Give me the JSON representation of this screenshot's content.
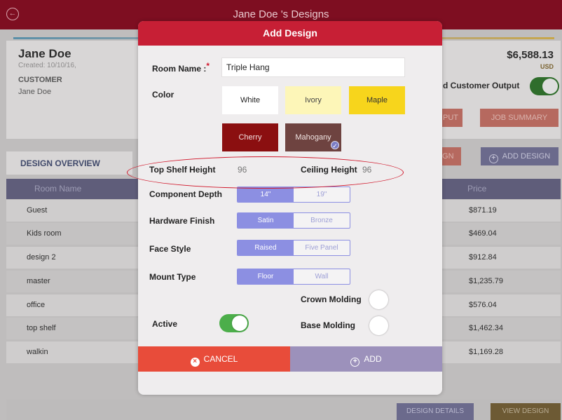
{
  "app": {
    "title": "Jane Doe 's Designs",
    "back_glyph": "←"
  },
  "customer": {
    "name": "Jane Doe",
    "created": "Created: 10/10/16,",
    "label": "CUSTOMER",
    "value": "Jane Doe",
    "total": "$6,588.13",
    "currency": "USD",
    "output_label": "d Customer Output",
    "output_on": true
  },
  "actions": {
    "output_partial": "PUT",
    "job_summary": "JOB SUMMARY",
    "design_partial": "IGN",
    "add_design": "ADD DESIGN"
  },
  "overview": {
    "tab": "DESIGN OVERVIEW",
    "col_room": "Room Name",
    "col_price": "Price",
    "rows": [
      {
        "name": "Guest",
        "price": "$871.19"
      },
      {
        "name": "Kids room",
        "price": "$469.04"
      },
      {
        "name": "design 2",
        "price": "$912.84"
      },
      {
        "name": "master",
        "price": "$1,235.79"
      },
      {
        "name": "office",
        "price": "$576.04"
      },
      {
        "name": "top shelf",
        "price": "$1,462.34"
      },
      {
        "name": "walkin",
        "price": "$1,169.28"
      }
    ]
  },
  "bottom": {
    "design_details": "DESIGN DETAILS",
    "view_design": "VIEW DESIGN"
  },
  "modal": {
    "title": "Add Design",
    "room_name_label": "Room Name :",
    "required_mark": "*",
    "room_name_value": "Triple Hang",
    "color_label": "Color",
    "colors": {
      "white": "White",
      "ivory": "Ivory",
      "maple": "Maple",
      "cherry": "Cherry",
      "mahogany": "Mahogany",
      "selected": "Mahogany",
      "check_glyph": "✓"
    },
    "top_shelf_label": "Top Shelf Height",
    "top_shelf_value": "96",
    "ceiling_label": "Ceiling Height",
    "ceiling_value": "96",
    "component_depth": {
      "label": "Component Depth",
      "options": [
        "14\"",
        "19\""
      ],
      "selected": "14\""
    },
    "hardware_finish": {
      "label": "Hardware Finish",
      "options": [
        "Satin",
        "Bronze"
      ],
      "selected": "Satin"
    },
    "face_style": {
      "label": "Face Style",
      "options": [
        "Raised",
        "Five Panel"
      ],
      "selected": "Raised"
    },
    "mount_type": {
      "label": "Mount Type",
      "options": [
        "Floor",
        "Wall"
      ],
      "selected": "Floor"
    },
    "crown_molding_label": "Crown Molding",
    "crown_molding_on": false,
    "active_label": "Active",
    "active_on": true,
    "base_molding_label": "Base Molding",
    "base_molding_on": false,
    "cancel_label": "CANCEL",
    "cancel_glyph": "×",
    "add_label": "ADD",
    "add_glyph": "+"
  },
  "colors": {
    "brand": "#c71f35",
    "accent": "#8c8fe2",
    "cancel": "#e84c3a",
    "add": "#9c91bb",
    "toggle_on": "#4cae4a"
  }
}
